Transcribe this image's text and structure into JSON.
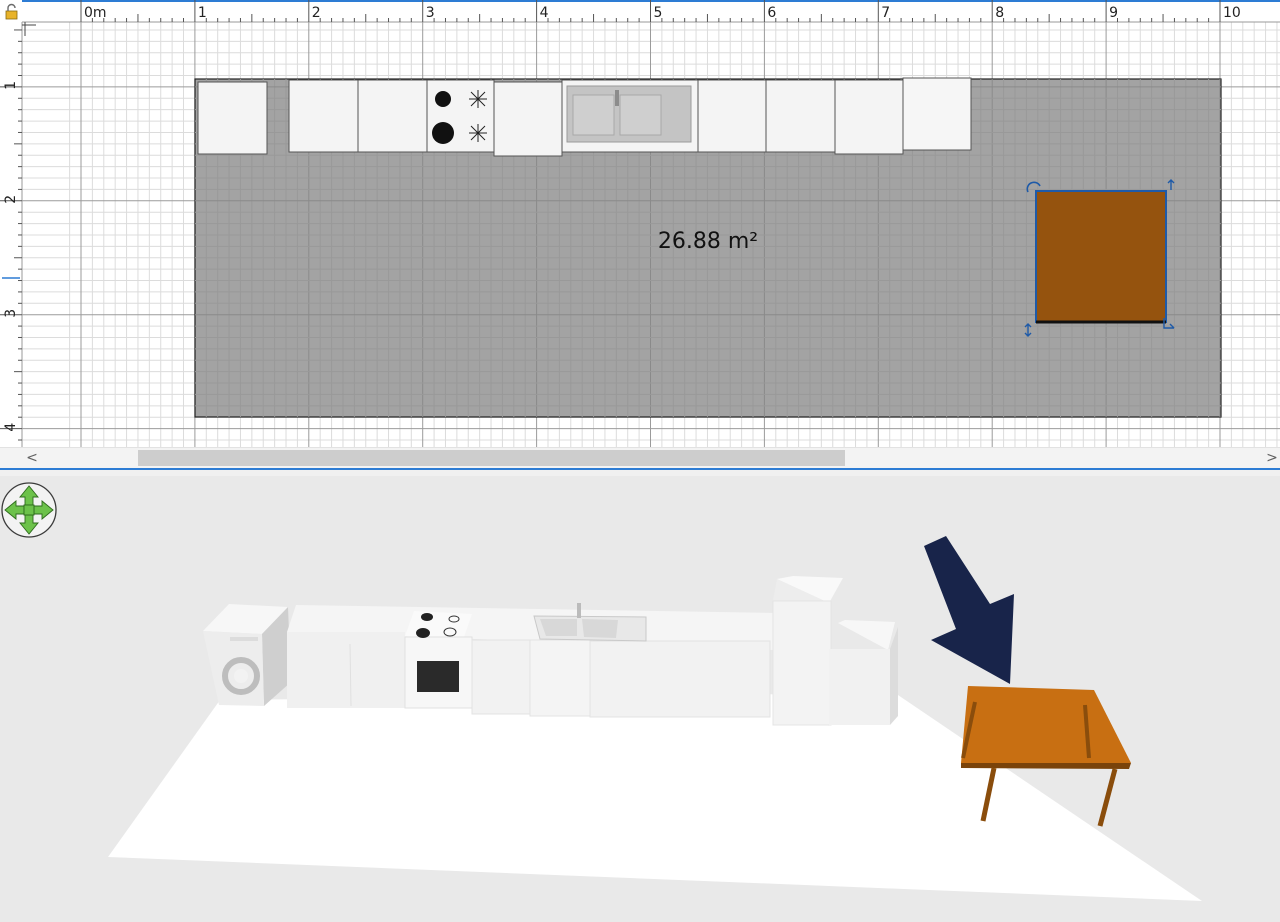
{
  "plan": {
    "ruler_x_labels": [
      "0m",
      "1",
      "2",
      "3",
      "4",
      "5",
      "6",
      "7",
      "8",
      "9",
      "10"
    ],
    "ruler_y_labels": [
      "1",
      "2",
      "3",
      "4"
    ],
    "room_area_label": "26.88 m²"
  },
  "scrollbar": {
    "left_arrow": "<",
    "right_arrow": ">"
  },
  "colors": {
    "floor": "#a3a3a3",
    "table_top": "#c86f12",
    "table_plan": "#95530e",
    "selection": "#1e5aa8",
    "navigation_green": "#6cc24a",
    "arrow_annotation": "#18244a"
  },
  "icons": {
    "lock": "lock-icon",
    "navigation": "navigation-arrows-icon"
  }
}
